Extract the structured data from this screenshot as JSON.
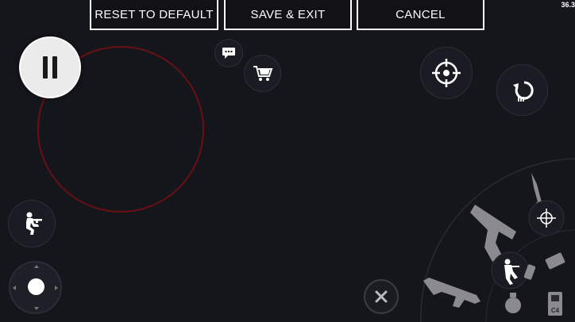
{
  "toolbar": {
    "reset_label": "RESET TO DEFAULT",
    "save_label": "SAVE & EXIT",
    "cancel_label": "CANCEL"
  },
  "fps": "36.3",
  "hud": {
    "pause_icon": "pause-icon",
    "chat_icon": "chat-bubble-icon",
    "shop_icon": "shopping-cart-icon",
    "scope_icon": "crosshair-icon",
    "reload_icon": "reload-icon",
    "crouch_icon": "crouching-soldier-icon",
    "joystick_icon": "movement-joystick",
    "cancel_icon": "close-icon"
  },
  "weapon_wheel": {
    "items": [
      "knife",
      "pistol",
      "grenade",
      "rifle",
      "c4",
      "drop",
      "buy-weapon",
      "flashbang"
    ],
    "c4_label": "C4"
  },
  "colors": {
    "background": "#15151c",
    "aim_ring": "#6a1014",
    "button_border": "#ffffff",
    "weapon_silhouette": "#8a8a8f"
  }
}
